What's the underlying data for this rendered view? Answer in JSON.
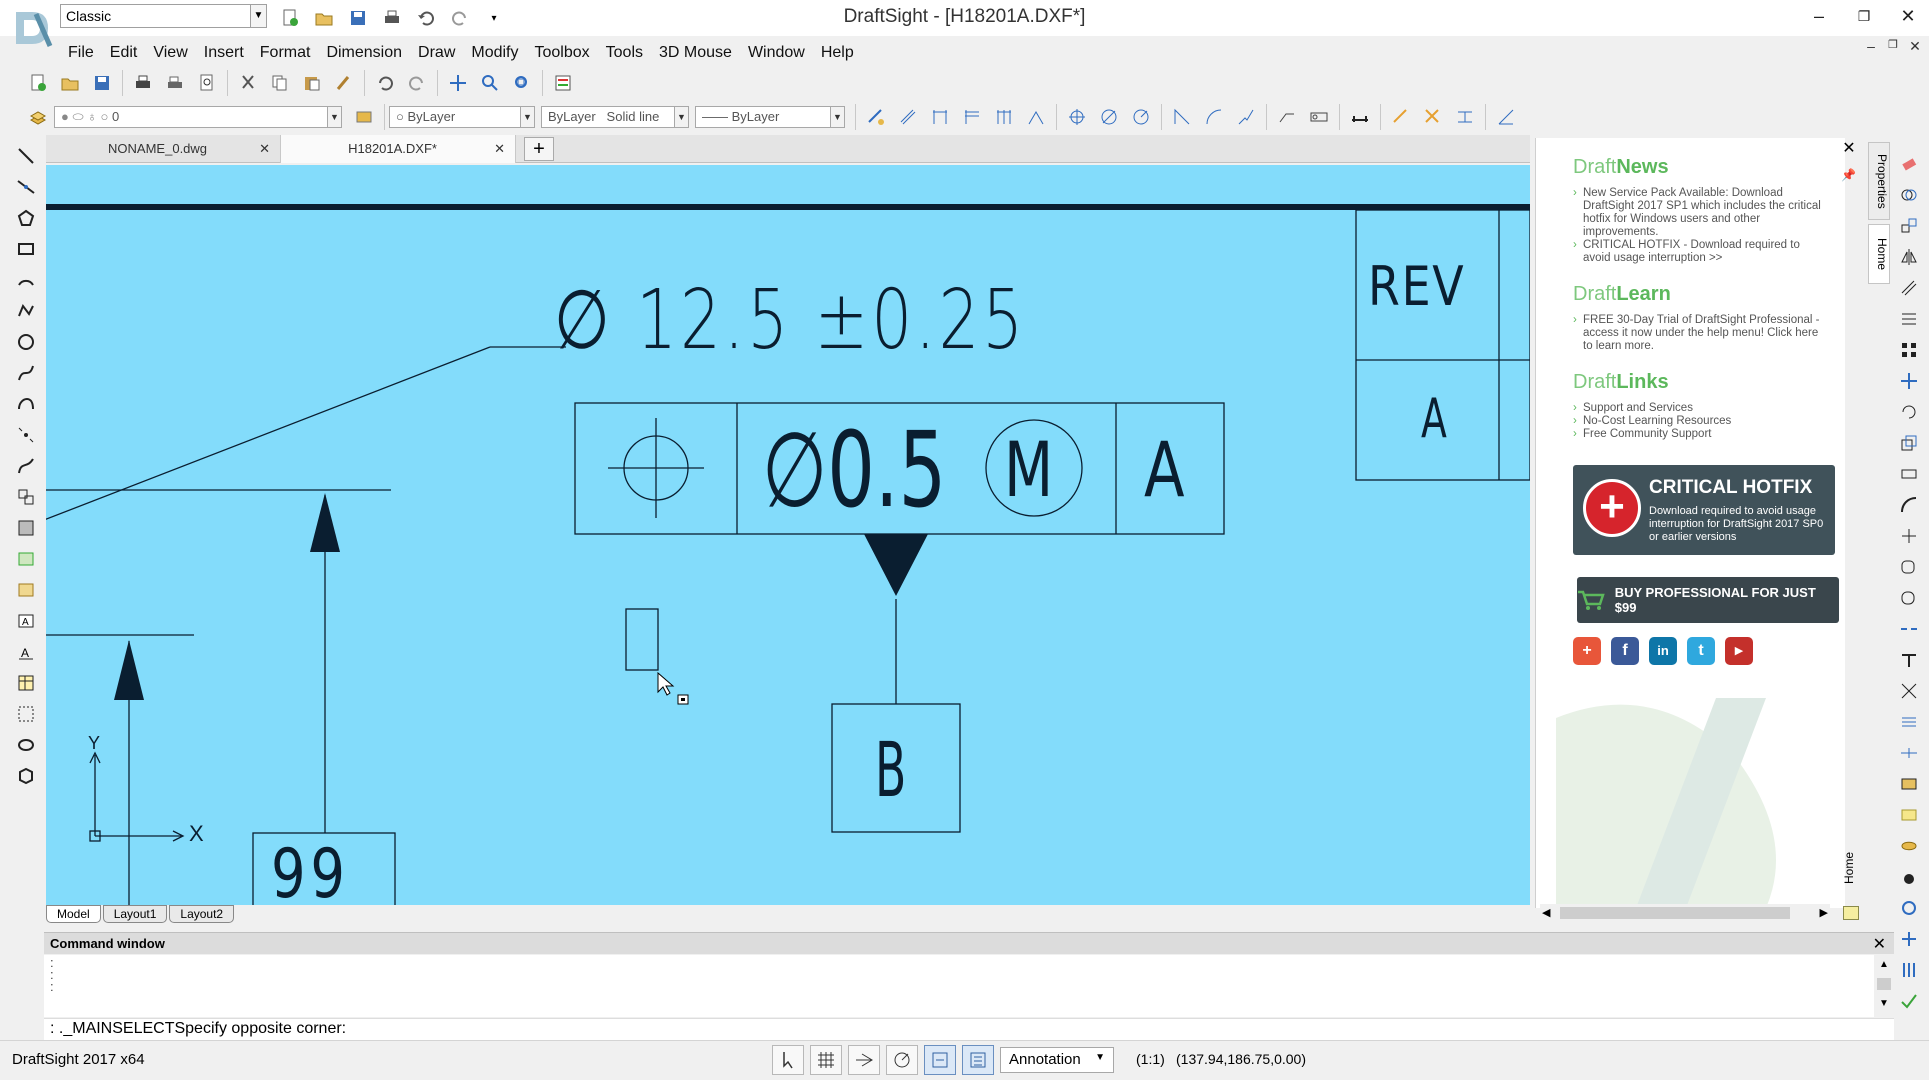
{
  "window": {
    "title": "DraftSight - [H18201A.DXF*]",
    "workspace": "Classic",
    "minimize_glyph": "–",
    "maximize_glyph": "❐",
    "close_glyph": "✕"
  },
  "menubar": [
    "File",
    "Edit",
    "View",
    "Insert",
    "Format",
    "Dimension",
    "Draw",
    "Modify",
    "Toolbox",
    "Tools",
    "3D Mouse",
    "Window",
    "Help"
  ],
  "layer_bar": {
    "layer": "0",
    "color": "ByLayer",
    "linetype_scale": "ByLayer",
    "linetype": "Solid line",
    "lineweight": "ByLayer"
  },
  "doc_tabs": [
    {
      "label": "NONAME_0.dwg",
      "active": false
    },
    {
      "label": "H18201A.DXF*",
      "active": true
    }
  ],
  "new_tab_glyph": "+",
  "layout_tabs": [
    "Model",
    "Layout1",
    "Layout2"
  ],
  "drawing": {
    "size_dimension": "∅ 12.5 ±0.25",
    "fcf_tolerance": "∅0.5",
    "fcf_modifier": "M",
    "fcf_datum": "A",
    "datum_label": "B",
    "revision_header": "REV",
    "revision_value": "A",
    "partial_number": "99",
    "ucs_x": "X",
    "ucs_y": "Y",
    "background_color": "#83dcfb"
  },
  "news_panel": {
    "draftnews_pre": "Draft",
    "draftnews_post": "News",
    "news_items": [
      "New Service Pack Available: Download DraftSight 2017 SP1 which includes the critical hotfix for Windows users and other improvements.",
      "CRITICAL HOTFIX - Download required to avoid usage interruption >>"
    ],
    "draftlearn_pre": "Draft",
    "draftlearn_post": "Learn",
    "learn_items": [
      "FREE 30-Day Trial of DraftSight Professional - access it now under the help menu! Click here to learn more."
    ],
    "draftlinks_pre": "Draft",
    "draftlinks_post": "Links",
    "link_items": [
      "Support and Services",
      "No-Cost Learning Resources",
      "Free Community Support"
    ],
    "hotfix_title": "CRITICAL HOTFIX",
    "hotfix_sub": "Download required to avoid usage interruption for DraftSight 2017 SP0 or earlier versions",
    "buy_label": "BUY PROFESSIONAL FOR JUST $99",
    "side_tab_properties": "Properties",
    "side_tab_home": "Home",
    "home_vtab": "Home",
    "accent": "#5cb85c"
  },
  "command_window": {
    "title": "Command window",
    "history": [
      ":",
      ":",
      ":"
    ],
    "prompt": ": ._MAINSELECTSpecify opposite corner:"
  },
  "statusbar": {
    "app": "DraftSight 2017 x64",
    "annotation": "Annotation",
    "scale": "(1:1)",
    "coordinates": "(137.94,186.75,0.00)"
  }
}
